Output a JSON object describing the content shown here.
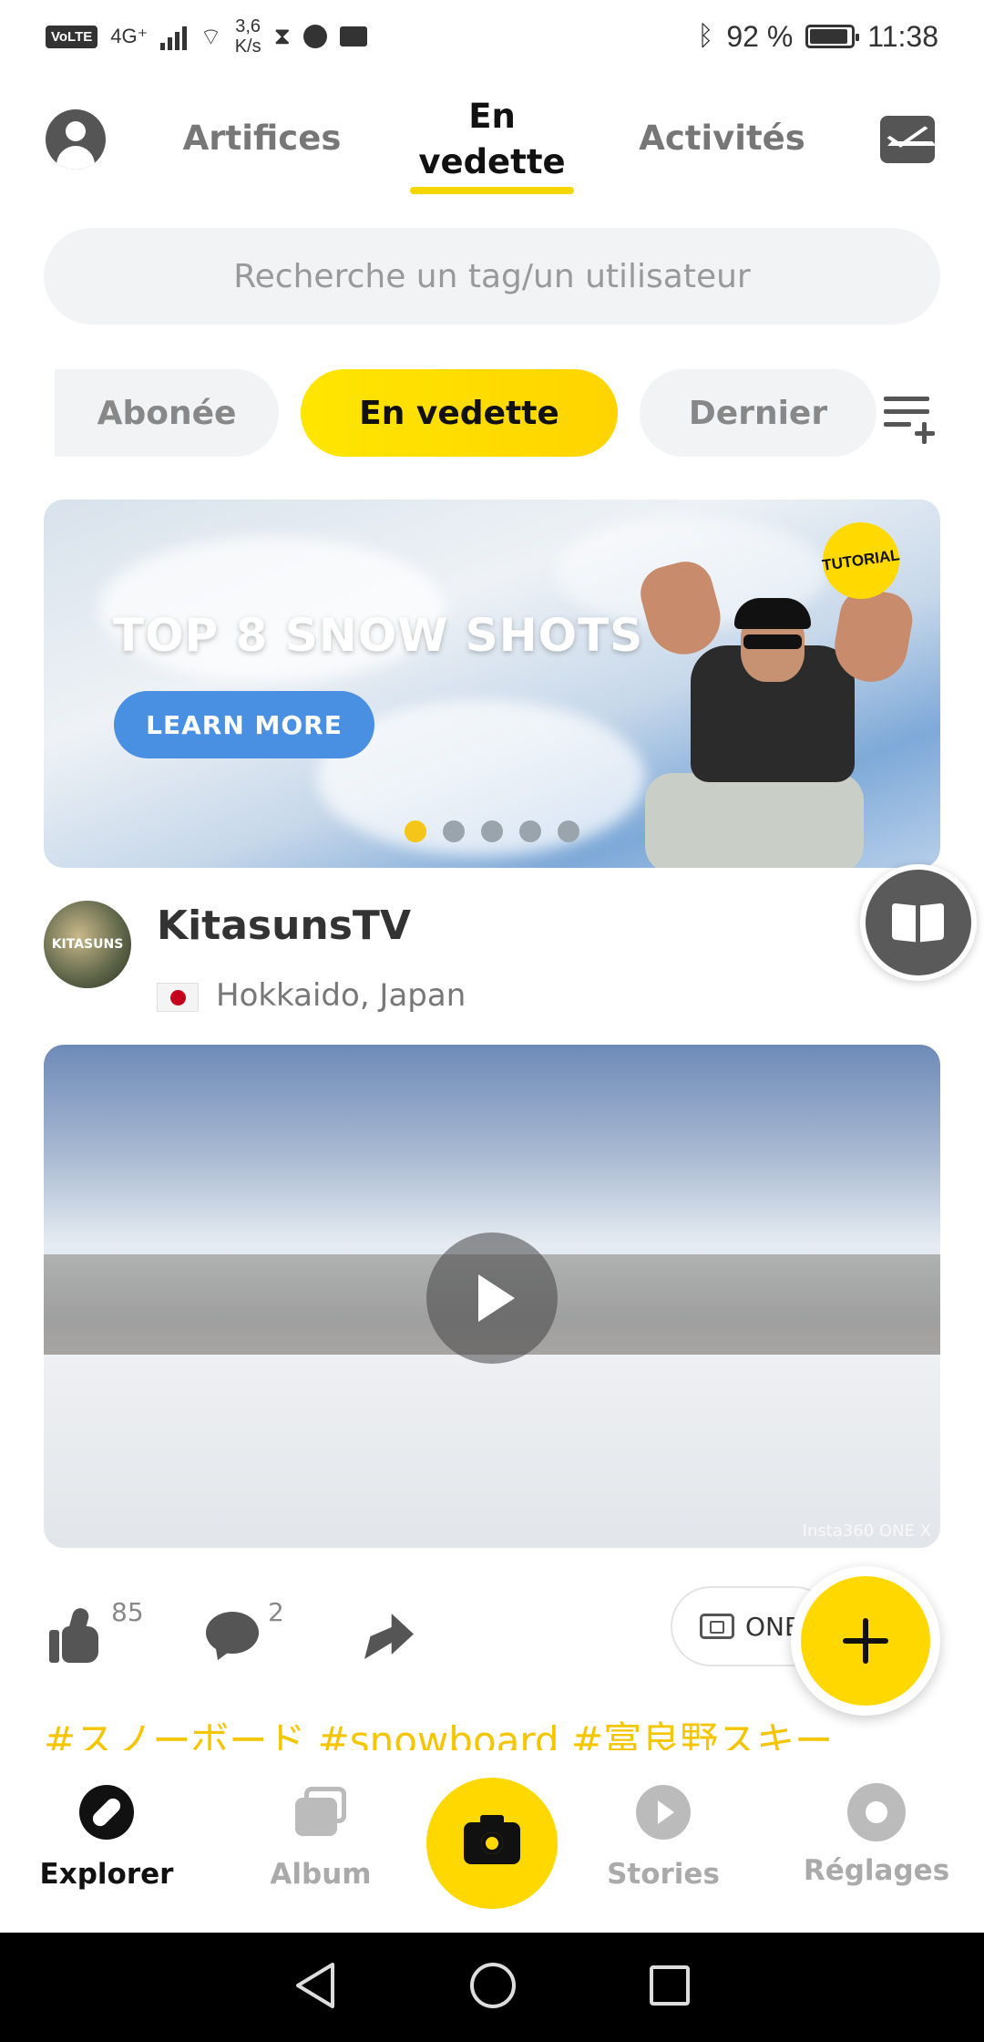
{
  "status_bar": {
    "volte": "VoLTE",
    "network": "4G⁺",
    "speed_value": "3,6",
    "speed_unit": "K/s",
    "battery": "92 %",
    "battery_level": 0.92,
    "time": "11:38"
  },
  "top_nav": {
    "tabs": [
      {
        "label": "Artifices"
      },
      {
        "label_line1": "En",
        "label_line2": "vedette"
      },
      {
        "label": "Activités"
      }
    ]
  },
  "search": {
    "placeholder": "Recherche un tag/un utilisateur"
  },
  "filters": [
    "Abonée",
    "En vedette",
    "Dernier"
  ],
  "banner": {
    "title": "TOP 8 SNOW SHOTS",
    "button": "LEARN MORE",
    "badge": "TUTORIAL",
    "slide_count": 5,
    "active_slide": 1
  },
  "post": {
    "username": "KitasunsTV",
    "avatar_text": "KITASUNS",
    "location": "Hokkaido, Japan",
    "watermark": "Insta360 ONE X",
    "likes": "85",
    "comments": "2",
    "camera_chip": "ONE",
    "tags": "#スノーボード #snowboard #富良野スキー"
  },
  "bottom_nav": {
    "items": [
      {
        "label": "Explorer",
        "icon": "compass-icon"
      },
      {
        "label": "Album",
        "icon": "album-icon"
      },
      {
        "label": "Stories",
        "icon": "play-circle-icon"
      },
      {
        "label": "Réglages",
        "icon": "gear-icon"
      }
    ]
  },
  "colors": {
    "accent": "#ffd800",
    "accent_text": "#f4c500",
    "button_blue": "#4a90e2"
  }
}
